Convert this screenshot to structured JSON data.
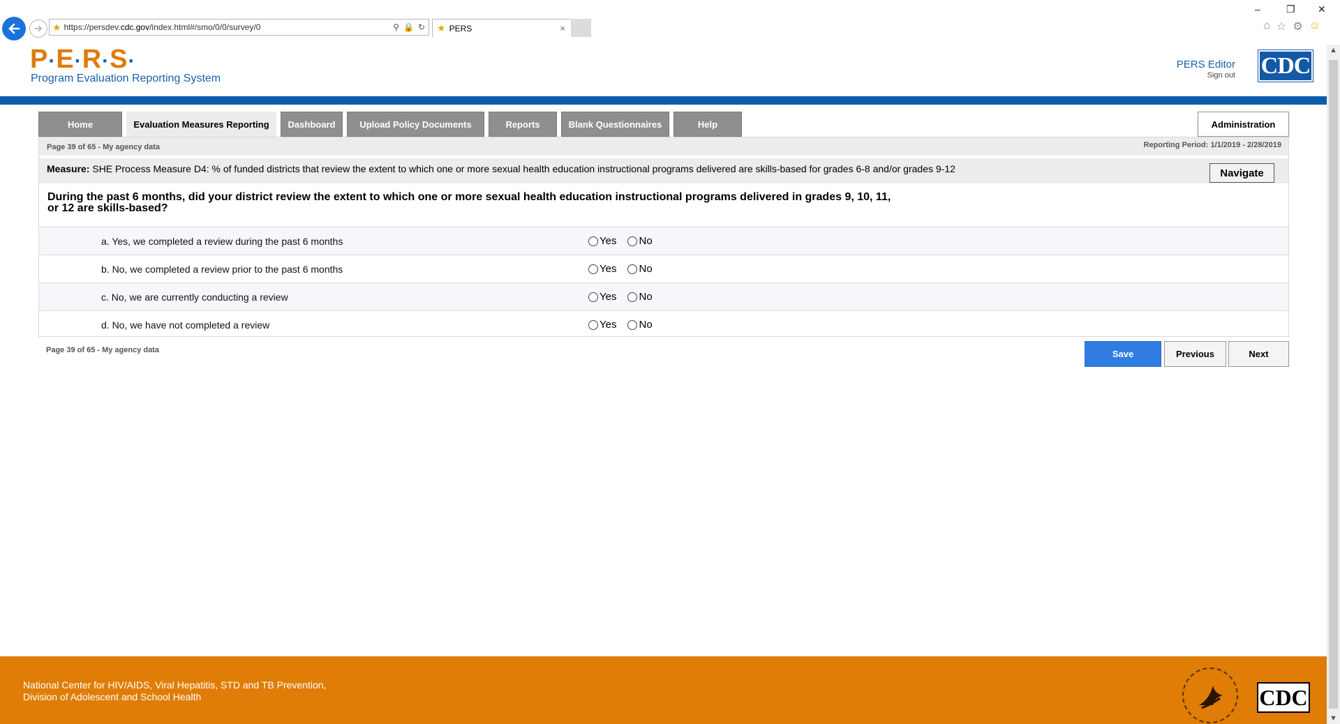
{
  "browser": {
    "url_prefix": "https://persdev.",
    "url_domain": "cdc.gov",
    "url_path": "/index.html#/smo/0/0/survey/0",
    "tab_title": "PERS",
    "tab_close": "×",
    "minimize": "–",
    "restore": "❐",
    "close": "✕"
  },
  "header": {
    "logo_letters": [
      "P",
      "E",
      "R",
      "S"
    ],
    "logo_separator": "·",
    "subtitle": "Program Evaluation Reporting System",
    "user_name": "PERS Editor",
    "sign_out": "Sign out",
    "cdc_logo_text": "CDC"
  },
  "nav": {
    "tabs": [
      {
        "label": "Home",
        "active": false
      },
      {
        "label": "Evaluation Measures Reporting",
        "active": true
      },
      {
        "label": "Dashboard",
        "active": false
      },
      {
        "label": "Upload Policy Documents",
        "active": false
      },
      {
        "label": "Reports",
        "active": false
      },
      {
        "label": "Blank Questionnaires",
        "active": false
      },
      {
        "label": "Help",
        "active": false
      }
    ],
    "admin_label": "Administration"
  },
  "survey": {
    "page_info": "Page 39 of 65 - My agency data",
    "reporting_period": "Reporting Period: 1/1/2019 - 2/28/2019",
    "measure_label": "Measure:",
    "measure_text": "SHE Process Measure D4: % of funded districts that review the extent to which one or more sexual health education instructional programs delivered are skills-based for grades 6-8 and/or grades 9-12",
    "navigate_label": "Navigate",
    "question_line1": "During the past 6 months, did your district review the extent to which one or more sexual health education instructional programs delivered in grades 9, 10, 11,",
    "question_line2": "or 12 are skills-based?",
    "options": [
      {
        "label": "a. Yes, we completed a review during the past 6 months",
        "yes": "Yes",
        "no": "No"
      },
      {
        "label": "b. No, we completed a review prior to the past 6 months",
        "yes": "Yes",
        "no": "No"
      },
      {
        "label": "c. No, we are currently conducting a review",
        "yes": "Yes",
        "no": "No"
      },
      {
        "label": "d. No, we have not completed a review",
        "yes": "Yes",
        "no": "No"
      }
    ],
    "bottom_page_info": "Page 39 of 65 - My agency data"
  },
  "actions": {
    "save": "Save",
    "previous": "Previous",
    "next": "Next"
  },
  "footer": {
    "line1": "National Center for HIV/AIDS, Viral Hepatitis, STD and TB Prevention,",
    "line2": "Division of Adolescent and School Health",
    "cdc_logo_text": "CDC"
  },
  "colors": {
    "brand_orange": "#df7d06",
    "brand_blue": "#0d5cab",
    "save_blue": "#2f7de1",
    "tab_gray": "#8f8f8f"
  }
}
